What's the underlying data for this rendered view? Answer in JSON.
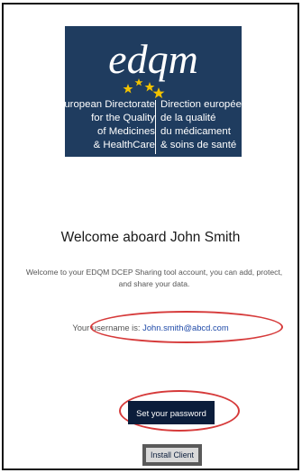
{
  "logo": {
    "wordmark": "edqm",
    "left_lines": [
      "European Directorate",
      "for the Quality",
      "of Medicines",
      "& HealthCare"
    ],
    "right_lines": [
      "Direction européenne",
      "de la qualité",
      "du médicament",
      "& soins de santé"
    ],
    "background": "#1f3c5f",
    "star_color": "#f2c200"
  },
  "welcome": {
    "title": "Welcome aboard John Smith",
    "description": "Welcome to your EDQM DCEP Sharing tool account, you can add, protect, and share your data."
  },
  "username": {
    "label": "Your username is:",
    "value": "John.smith@abcd.com"
  },
  "actions": {
    "set_password_label": "Set your password",
    "install_client_label": "Install Client"
  },
  "colors": {
    "annotation_red": "#d63a3a",
    "button_dark": "#0b1d3b",
    "link_blue": "#1f4aa8"
  }
}
